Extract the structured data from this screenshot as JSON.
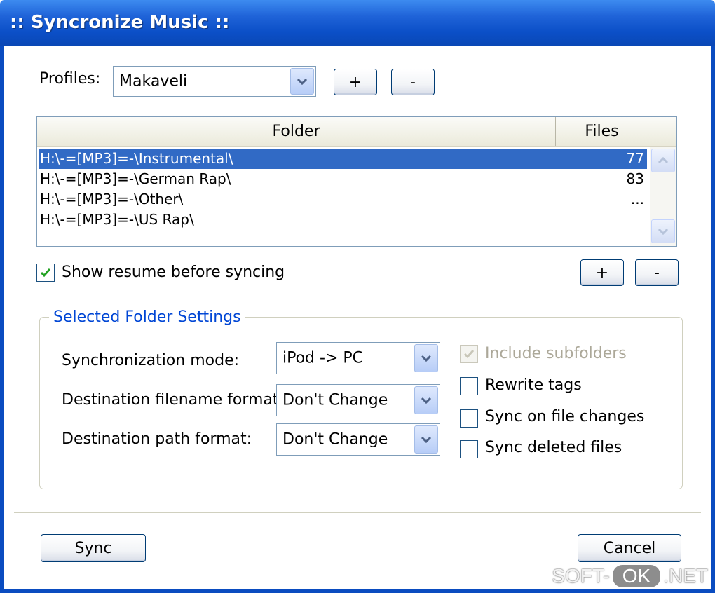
{
  "window": {
    "title": ":: Syncronize Music ::"
  },
  "profiles": {
    "label": "Profiles:",
    "selected": "Makaveli",
    "add_label": "+",
    "remove_label": "-"
  },
  "folder_list": {
    "columns": {
      "folder": "Folder",
      "files": "Files"
    },
    "rows": [
      {
        "folder": "H:\\-=[MP3]=-\\Instrumental\\",
        "files": "77",
        "selected": true
      },
      {
        "folder": "H:\\-=[MP3]=-\\German Rap\\",
        "files": "83",
        "selected": false
      },
      {
        "folder": "H:\\-=[MP3]=-\\Other\\",
        "files": "...",
        "selected": false
      },
      {
        "folder": "H:\\-=[MP3]=-\\US Rap\\",
        "files": "",
        "selected": false
      }
    ],
    "add_label": "+",
    "remove_label": "-"
  },
  "show_resume": {
    "label": "Show resume before syncing",
    "checked": true
  },
  "folder_settings": {
    "title": "Selected Folder Settings",
    "sync_mode": {
      "label": "Synchronization mode:",
      "value": "iPod -> PC"
    },
    "filename_format": {
      "label": "Destination filename format:",
      "value": "Don't Change"
    },
    "path_format": {
      "label": "Destination path format:",
      "value": "Don't Change"
    },
    "include_subfolders": {
      "label": "Include subfolders",
      "checked": true,
      "enabled": false
    },
    "rewrite_tags": {
      "label": "Rewrite tags",
      "checked": false
    },
    "sync_on_changes": {
      "label": "Sync on file changes",
      "checked": false
    },
    "sync_deleted": {
      "label": "Sync deleted files",
      "checked": false
    }
  },
  "footer": {
    "sync_label": "Sync",
    "cancel_label": "Cancel"
  },
  "watermark": {
    "left": "SOFT-",
    "mid": "OK",
    "right": ".NET"
  },
  "colors": {
    "title_bar": "#0a4cc0",
    "selection": "#316ac5",
    "group_title": "#0046d5"
  }
}
